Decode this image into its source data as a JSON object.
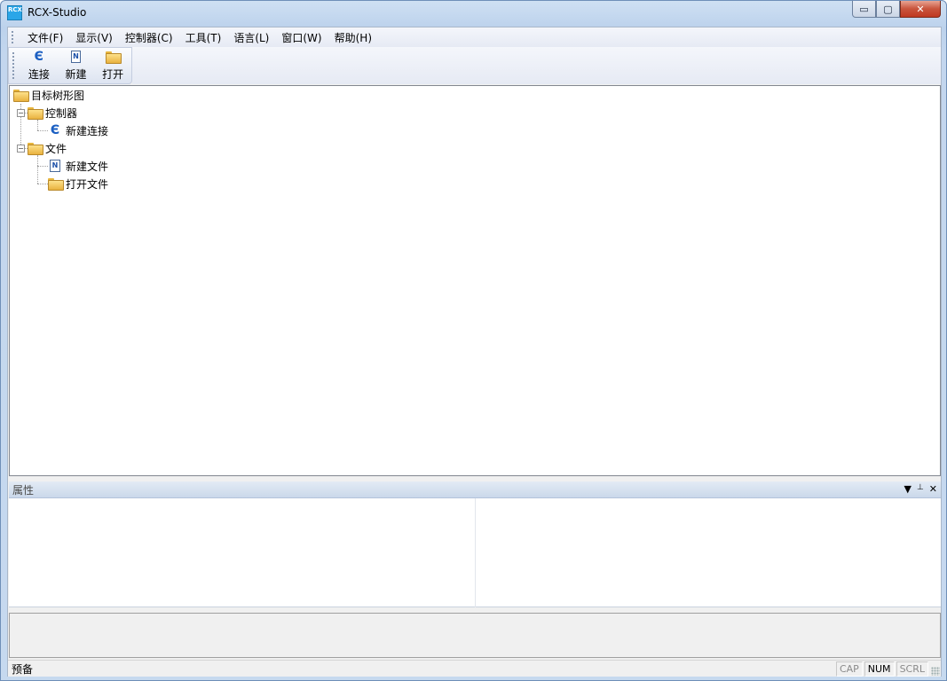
{
  "window": {
    "title": "RCX-Studio",
    "icon_text": "RCX",
    "buttons": {
      "minimize": "▭",
      "maximize": "▢",
      "close": "✕"
    }
  },
  "menubar": {
    "items": [
      {
        "label": "文件(F)"
      },
      {
        "label": "显示(V)"
      },
      {
        "label": "控制器(C)"
      },
      {
        "label": "工具(T)"
      },
      {
        "label": "语言(L)"
      },
      {
        "label": "窗口(W)"
      },
      {
        "label": "帮助(H)"
      }
    ]
  },
  "toolbar": {
    "buttons": [
      {
        "label": "连接",
        "icon": "connect-icon"
      },
      {
        "label": "新建",
        "icon": "new-file-icon"
      },
      {
        "label": "打开",
        "icon": "open-folder-icon"
      }
    ]
  },
  "tree": {
    "root": "目标树形图",
    "controller": {
      "label": "控制器",
      "child": "新建连接"
    },
    "files": {
      "label": "文件",
      "children": [
        "新建文件",
        "打开文件"
      ]
    }
  },
  "properties": {
    "title": "属性",
    "tools": {
      "dropdown": "▼",
      "pin": "📌",
      "close": "✕"
    }
  },
  "statusbar": {
    "text": "预备",
    "indicators": {
      "cap": "CAP",
      "num": "NUM",
      "scrl": "SCRL"
    }
  },
  "colors": {
    "accent": "#1b5fc2",
    "folder": "#e9b23f",
    "close_button": "#c8543c"
  }
}
